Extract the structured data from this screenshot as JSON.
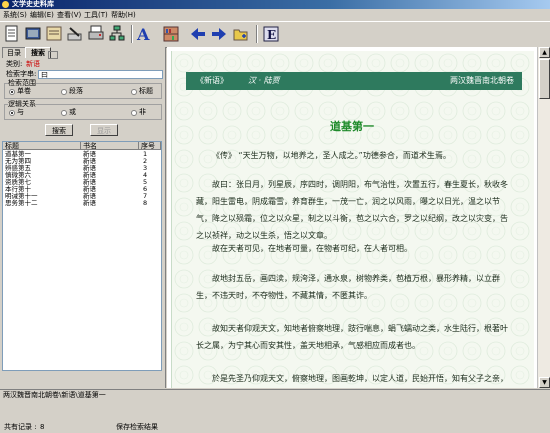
{
  "window": {
    "title": "文学史史料库"
  },
  "menu": [
    "系统(S)",
    "编辑(E)",
    "查看(V)",
    "工具(T)",
    "帮助(H)"
  ],
  "toolbar": {
    "icons": [
      "page-icon",
      "book-icon",
      "manuscript-icon",
      "pen-icon",
      "print-icon",
      "tree-icon",
      "font-icon",
      "bookcase-icon",
      "back-arrow-icon",
      "forward-arrow-icon",
      "folder-add-icon",
      "e-icon"
    ]
  },
  "left_panel": {
    "tabs": [
      "目录",
      "搜索"
    ],
    "category_label": "类别:",
    "category_value": "新语",
    "keyword_label": "检索字串:",
    "keyword_value": "曰",
    "scope": {
      "title": "检索范围",
      "options": [
        "单卷",
        "段落",
        "标题"
      ],
      "selected": 0
    },
    "logic": {
      "title": "逻辑关系",
      "options": [
        "与",
        "或",
        "非"
      ],
      "selected": 0
    },
    "search_button": "搜索",
    "show_button": "显示",
    "results": {
      "headers": [
        "标题",
        "书名",
        "序号"
      ],
      "rows": [
        [
          "道基第一",
          "新语",
          "1"
        ],
        [
          "无为第四",
          "新语",
          "2"
        ],
        [
          "辨惑第五",
          "新语",
          "3"
        ],
        [
          "慎微第六",
          "新语",
          "4"
        ],
        [
          "资质第七",
          "新语",
          "5"
        ],
        [
          "本行第十",
          "新语",
          "6"
        ],
        [
          "明诫第十一",
          "新语",
          "7"
        ],
        [
          "思务第十二",
          "新语",
          "8"
        ]
      ]
    },
    "record_count_label": "共有记录 :",
    "record_count": "8",
    "save_results": "保存检索结果"
  },
  "reader": {
    "banner_left": "《新语》",
    "banner_mid": "汉 · 陆贾",
    "banner_right": "两汉魏晋南北朝卷",
    "title": "道基第一",
    "paragraphs": [
      "《传》  “天生万物，以地养之，圣人成之。”功德参合，而道术生焉。",
      "故曰：张日月，列星辰，序四时，调阴阳，布气治性，次置五行，春生夏长，秋收冬藏，阳生雷电，阴成霜雪，养育群生，一茂一亡，润之以风雨，曝之以日光，温之以节气，降之以殒霜，位之以众星，制之以斗衡，苞之以六合，罗之以纪纲，改之以灾变，告之以祯祥，动之以生杀，悟之以文章。",
      "故在天者可见，在地者可量，在物者可纪，在人者可相。",
      "故地封五岳，画四渎，规洿泽，通水泉，树物养类，苞植万根，暴形养精，以立群生，不违天时，不夺物性，不藏其情，不匿其诈。",
      "故知天者仰观天文，知地者俯察地理，跂行喘息，蜎飞蠕动之类，水生陆行，根著叶长之属，为宁其心而安其性，盖天地相承，气感相应而成者也。",
      "於是先圣乃仰观天文，俯察地理，图画乾坤，以定人道，民始开悟，知有父子之亲，君臣之义，夫妇之别，长幼之序，於是百官立，王道乃生。"
    ]
  },
  "status": {
    "path": "两汉魏晋南北朝卷\\新语\\道基第一"
  }
}
